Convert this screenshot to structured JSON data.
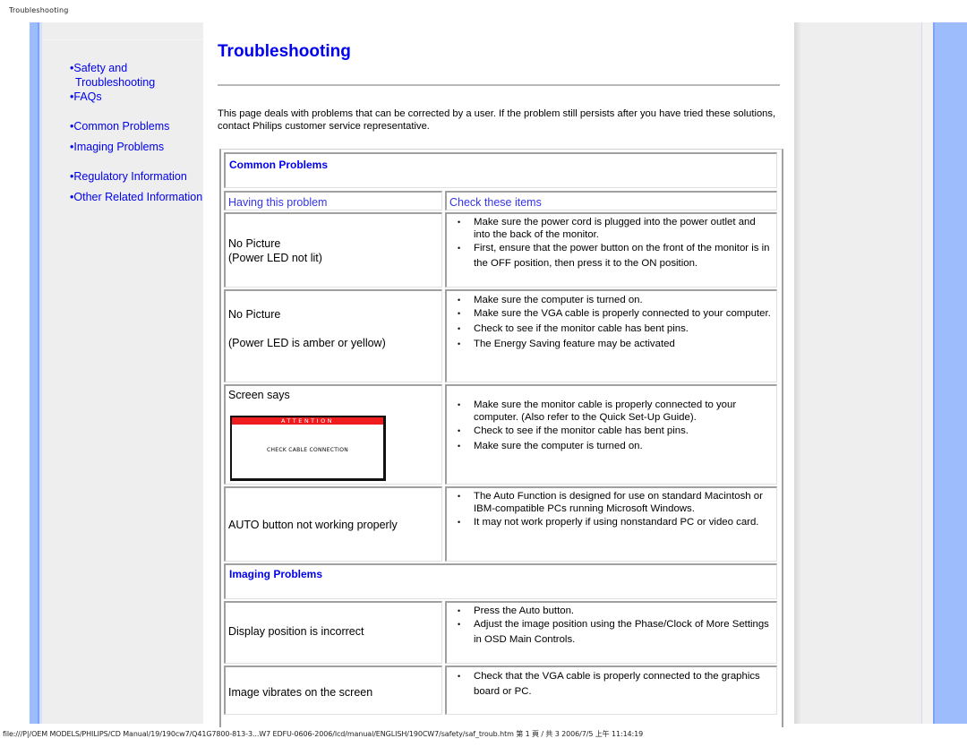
{
  "browser": {
    "header_title": "Troubleshooting",
    "footer_path": "file:///P|/OEM MODELS/PHILIPS/CD Manual/19/190cw7/Q41G7800-813-3...W7 EDFU-0606-2006/lcd/manual/ENGLISH/190CW7/safety/saf_troub.htm 第 1 頁 / 共 3 2006/7/5 上午 11:14:19"
  },
  "sidebar": {
    "items": [
      {
        "label_line1": "•Safety and",
        "label_line2": "Troubleshooting"
      },
      {
        "label": "•FAQs"
      },
      {
        "label": "•Common Problems"
      },
      {
        "label": "•Imaging Problems"
      },
      {
        "label": "•Regulatory Information"
      },
      {
        "label": "•Other Related Information"
      }
    ]
  },
  "main": {
    "title": "Troubleshooting",
    "intro": "This page deals with problems that can be corrected by a user. If the problem still persists after you have tried these solutions, contact Philips customer service representative.",
    "sections": [
      {
        "title": "Common Problems",
        "col_problem": "Having this problem",
        "col_check": "Check these items",
        "rows": [
          {
            "problem": [
              "No Picture",
              "(Power LED not lit)"
            ],
            "checks": [
              "Make sure the power cord is plugged into the power outlet and into the back of the monitor.",
              "First, ensure that the power button on the front of the monitor is in the OFF position, then press it to the ON position."
            ]
          },
          {
            "problem": [
              "No Picture",
              "(Power LED is amber or yellow)"
            ],
            "checks": [
              "Make sure the computer is turned on.",
              "Make sure the VGA cable is properly connected to your computer.",
              "Check to see if the monitor cable has bent pins.",
              "The Energy Saving feature may be activated"
            ]
          },
          {
            "problem": [
              "Screen says"
            ],
            "screen_image": {
              "header": "ATTENTION",
              "message": "CHECK CABLE CONNECTION",
              "header_color": "#ee1c1c"
            },
            "checks": [
              "Make sure the monitor cable is properly connected to your computer. (Also refer to the Quick Set-Up Guide).",
              "Check to see if the monitor cable has bent pins.",
              "Make sure the computer is turned on."
            ]
          },
          {
            "problem": [
              "AUTO button not working properly"
            ],
            "checks": [
              "The Auto Function is designed for use on standard Macintosh or IBM-compatible PCs running Microsoft Windows.",
              "It may not work properly if using nonstandard PC or video card."
            ]
          }
        ]
      },
      {
        "title": "Imaging Problems",
        "rows": [
          {
            "problem": [
              "Display position is incorrect"
            ],
            "checks": [
              "Press the Auto button.",
              "Adjust the image position using the Phase/Clock of More Settings in OSD Main Controls."
            ]
          },
          {
            "problem": [
              "Image vibrates on the screen"
            ],
            "checks": [
              "Check that the VGA cable is properly connected to the graphics board or PC."
            ]
          }
        ]
      }
    ]
  },
  "colors": {
    "link": "#0000ee",
    "accent_blue_stripe": "#9dbcfb",
    "panel_gray": "#eeeeee"
  }
}
